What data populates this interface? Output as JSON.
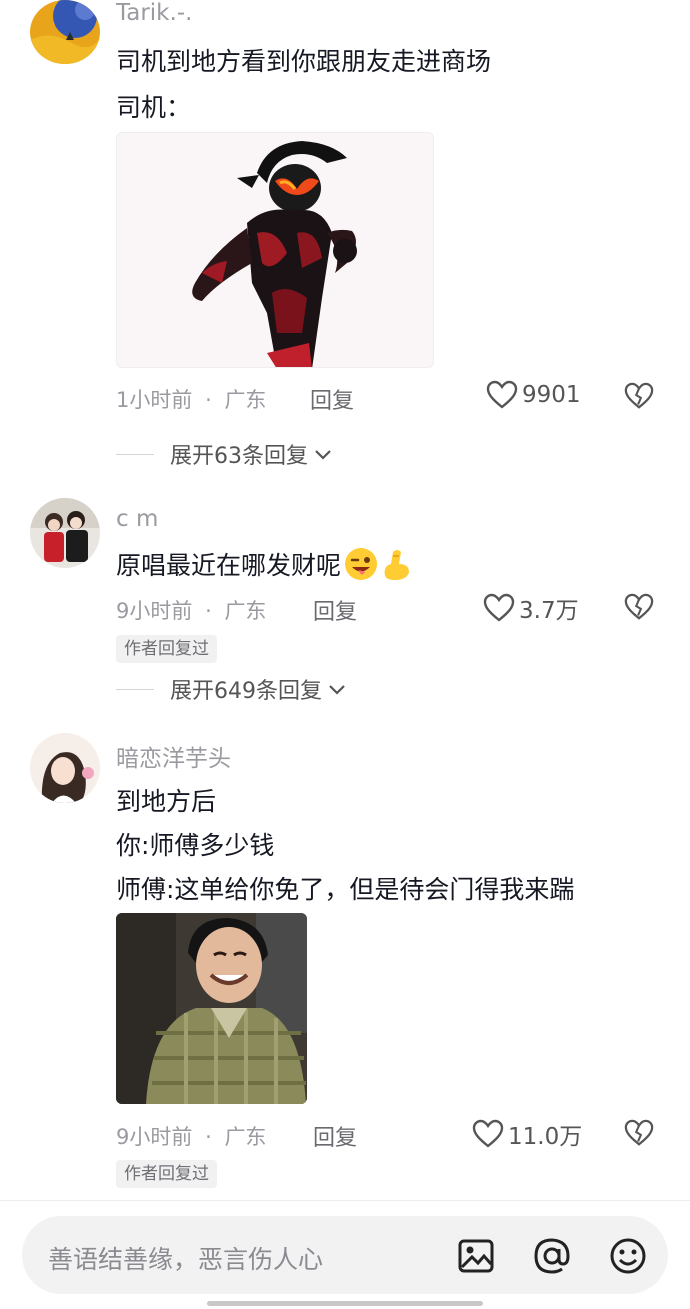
{
  "comments": [
    {
      "username": "Tarik.-.",
      "lines": [
        "司机到地方看到你跟朋友走进商场",
        "司机："
      ],
      "time": "1小时前",
      "location": "广东",
      "reply_label": "回复",
      "likes": "9901",
      "expand_label": "展开63条回复"
    },
    {
      "username": "c m",
      "lines": [
        "原唱最近在哪发财呢"
      ],
      "time": "9小时前",
      "location": "广东",
      "reply_label": "回复",
      "likes": "3.7万",
      "author_badge": "作者回复过",
      "expand_label": "展开649条回复"
    },
    {
      "username": "暗恋洋芋头",
      "lines": [
        "到地方后",
        "你:师傅多少钱",
        "师傅:这单给你免了，但是待会门得我来踹"
      ],
      "time": "9小时前",
      "location": "广东",
      "reply_label": "回复",
      "likes": "11.0万",
      "author_badge": "作者回复过"
    }
  ],
  "separator": "·",
  "input": {
    "placeholder": "善语结善缘，恶言伤人心",
    "icons": [
      "image-icon",
      "at-icon",
      "emoji-icon"
    ]
  }
}
